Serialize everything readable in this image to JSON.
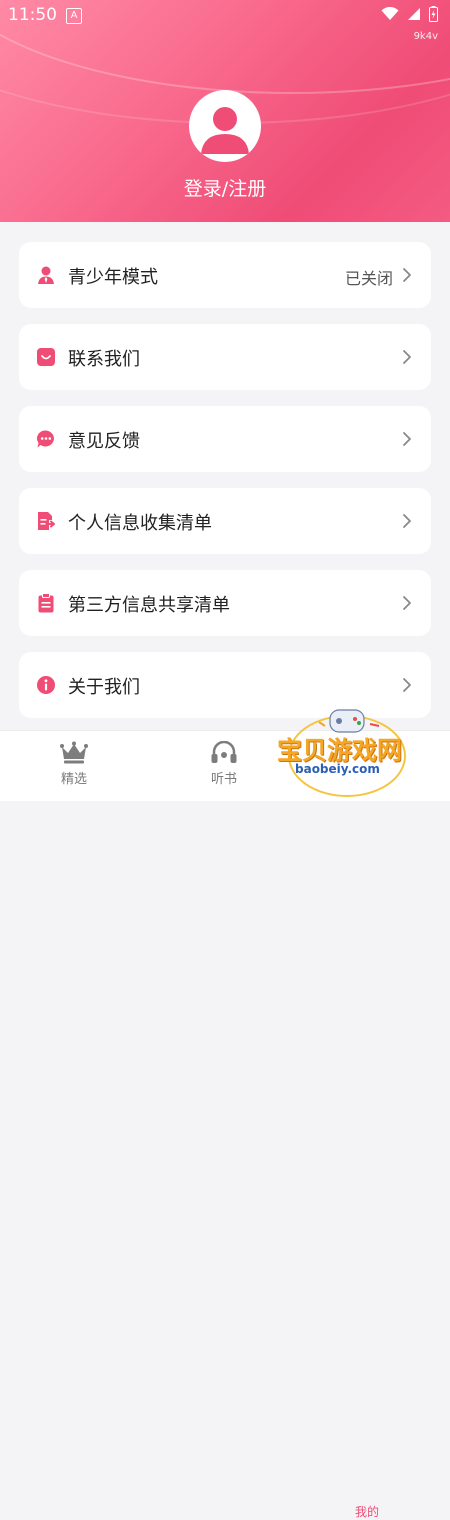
{
  "status_bar": {
    "time": "11:50",
    "badge_letter": "A",
    "tag": "9k4v"
  },
  "profile": {
    "login_label": "登录/注册"
  },
  "menu": [
    {
      "label": "青少年模式",
      "value": "已关闭",
      "icon": "person-tie-icon"
    },
    {
      "label": "联系我们",
      "value": "",
      "icon": "chat-bubble-icon"
    },
    {
      "label": "意见反馈",
      "value": "",
      "icon": "message-dots-icon"
    },
    {
      "label": "个人信息收集清单",
      "value": "",
      "icon": "document-export-icon"
    },
    {
      "label": "第三方信息共享清单",
      "value": "",
      "icon": "clipboard-icon"
    },
    {
      "label": "关于我们",
      "value": "",
      "icon": "info-icon"
    }
  ],
  "tabbar": {
    "tabs": [
      {
        "label": "精选",
        "icon": "crown-icon"
      },
      {
        "label": "听书",
        "icon": "headphones-icon"
      }
    ],
    "partial_tab_label": "我的"
  },
  "watermark": {
    "text": "宝贝游戏网",
    "url": "baobeiy.com"
  },
  "colors": {
    "accent": "#ef4c76",
    "header_light": "#ff8aa6",
    "background": "#f4f4f6"
  }
}
